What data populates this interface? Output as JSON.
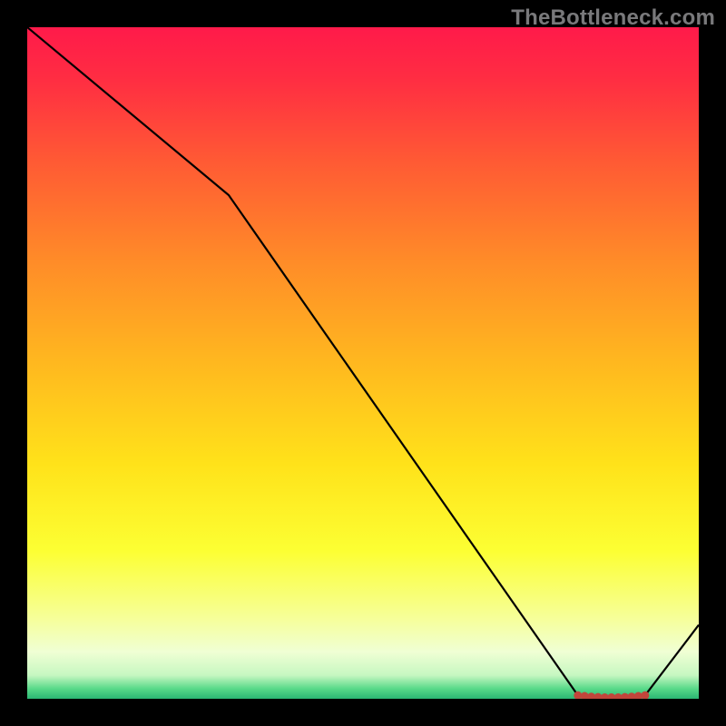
{
  "watermark": "TheBottleneck.com",
  "chart_data": {
    "type": "line",
    "title": "",
    "xlabel": "",
    "ylabel": "",
    "xlim": [
      0,
      100
    ],
    "ylim": [
      0,
      100
    ],
    "grid": false,
    "legend": false,
    "x": [
      0,
      30,
      82,
      86,
      88,
      92,
      100
    ],
    "y": [
      100,
      75,
      0.5,
      0.2,
      0.2,
      0.5,
      11
    ],
    "series": [
      {
        "name": "bottleneck-curve",
        "color": "#000000",
        "x": [
          0,
          30,
          82,
          86,
          88,
          92,
          100
        ],
        "y": [
          100,
          75,
          0.5,
          0.2,
          0.2,
          0.5,
          11
        ]
      }
    ],
    "background_gradient": {
      "stops": [
        {
          "offset": 0.0,
          "color": "#ff1a4a"
        },
        {
          "offset": 0.08,
          "color": "#ff2e42"
        },
        {
          "offset": 0.2,
          "color": "#ff5a34"
        },
        {
          "offset": 0.35,
          "color": "#ff8c28"
        },
        {
          "offset": 0.5,
          "color": "#ffb81f"
        },
        {
          "offset": 0.65,
          "color": "#ffe21a"
        },
        {
          "offset": 0.78,
          "color": "#fcff33"
        },
        {
          "offset": 0.88,
          "color": "#f6ff99"
        },
        {
          "offset": 0.93,
          "color": "#f0ffd4"
        },
        {
          "offset": 0.965,
          "color": "#c6f7c1"
        },
        {
          "offset": 0.985,
          "color": "#58d989"
        },
        {
          "offset": 1.0,
          "color": "#2bb673"
        }
      ]
    },
    "markers": {
      "color": "#c1453b",
      "points": [
        {
          "x": 82.0,
          "y": 0.5
        },
        {
          "x": 83.0,
          "y": 0.4
        },
        {
          "x": 84.0,
          "y": 0.3
        },
        {
          "x": 85.0,
          "y": 0.25
        },
        {
          "x": 86.0,
          "y": 0.2
        },
        {
          "x": 87.0,
          "y": 0.2
        },
        {
          "x": 88.0,
          "y": 0.2
        },
        {
          "x": 89.0,
          "y": 0.25
        },
        {
          "x": 90.0,
          "y": 0.3
        },
        {
          "x": 91.0,
          "y": 0.4
        },
        {
          "x": 92.0,
          "y": 0.5
        }
      ]
    }
  }
}
